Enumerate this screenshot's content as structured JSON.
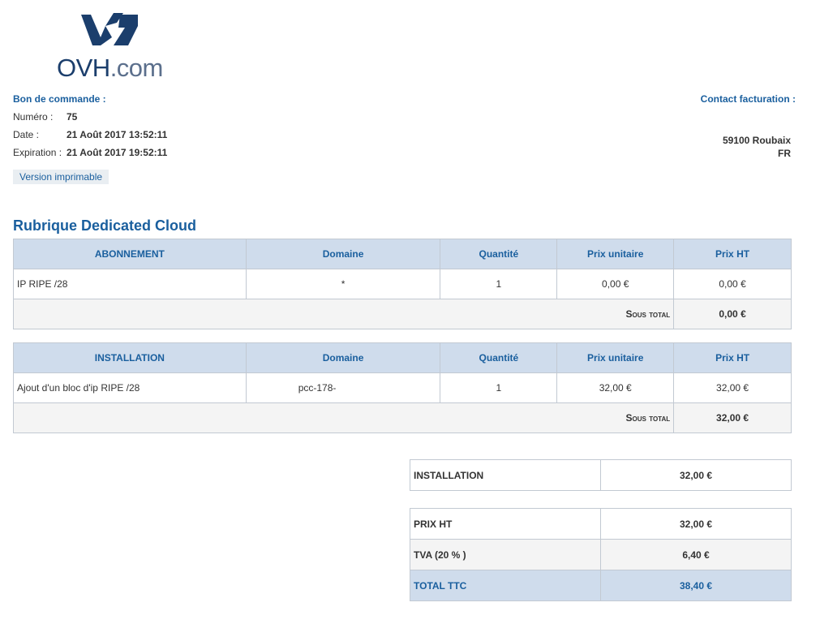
{
  "logo": {
    "brand": "OVH",
    "suffix": ".com"
  },
  "order": {
    "heading": "Bon de commande :",
    "number_label": "Numéro :",
    "number_value": "75",
    "date_label": "Date :",
    "date_value": "21 Août 2017 13:52:11",
    "expiration_label": "Expiration :",
    "expiration_value": "21 Août 2017 19:52:11",
    "print_label": "Version imprimable"
  },
  "billing": {
    "heading": "Contact facturation :",
    "city": "59100 Roubaix",
    "country": "FR"
  },
  "section_title": "Rubrique Dedicated Cloud",
  "tables": [
    {
      "headers": [
        "ABONNEMENT",
        "Domaine",
        "Quantité",
        "Prix unitaire",
        "Prix HT"
      ],
      "row": [
        "IP RIPE /28",
        "*",
        "1",
        "0,00 €",
        "0,00 €"
      ],
      "subtotal_label": "Sous total",
      "subtotal_value": "0,00 €"
    },
    {
      "headers": [
        "INSTALLATION",
        "Domaine",
        "Quantité",
        "Prix unitaire",
        "Prix HT"
      ],
      "row": [
        "Ajout d'un bloc d'ip RIPE /28",
        "pcc-178-",
        "1",
        "32,00 €",
        "32,00 €"
      ],
      "subtotal_label": "Sous total",
      "subtotal_value": "32,00 €"
    }
  ],
  "summary": {
    "installation_label": "INSTALLATION",
    "installation_value": "32,00 €",
    "prix_ht_label": "PRIX HT",
    "prix_ht_value": "32,00 €",
    "tva_label": "TVA (20 % )",
    "tva_value": "6,40 €",
    "ttc_label": "TOTAL TTC",
    "ttc_value": "38,40 €"
  },
  "colors": {
    "accent": "#1a5f9e",
    "header_bg": "#cfdcec",
    "logo_dark": "#1b3e6c"
  }
}
